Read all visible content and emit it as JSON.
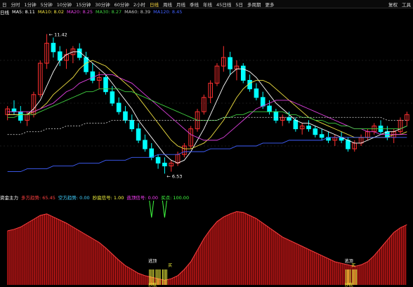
{
  "toolbar": {
    "items": [
      "日",
      "分时",
      "1分钟",
      "5分钟",
      "10分钟",
      "15分钟",
      "30分钟",
      "60分钟",
      "2小时",
      "日线",
      "周线",
      "月线",
      "季线",
      "年线",
      "45日线",
      "5日",
      "多周期",
      "更多"
    ],
    "active_index": 9,
    "right_items": [
      "复权",
      "工具"
    ]
  },
  "ma_header": {
    "title": "日线",
    "items": [
      {
        "label": "MA5",
        "value": "8.11",
        "color": "#ffffff"
      },
      {
        "label": "MA10",
        "value": "8.02",
        "color": "#f0e040"
      },
      {
        "label": "MA20",
        "value": "8.25",
        "color": "#e040e0"
      },
      {
        "label": "MA30",
        "value": "8.27",
        "color": "#40d040"
      },
      {
        "label": "MA60",
        "value": "8.39",
        "color": "#c0c0c0"
      },
      {
        "label": "MA120",
        "value": "8.45",
        "color": "#4060ff"
      }
    ]
  },
  "price_labels": {
    "high": "11.42",
    "low": "6.53"
  },
  "sub_header": {
    "items": [
      {
        "text": "资金主力",
        "color": "#ffffff"
      },
      {
        "text": "多方趋势: 65.45",
        "color": "#ff4040"
      },
      {
        "text": "空方趋势: 0.00",
        "color": "#40d0ff"
      },
      {
        "text": "抄底信号: 1.00",
        "color": "#ffff40"
      },
      {
        "text": "逃顶信号: 0.00",
        "color": "#ff40ff"
      },
      {
        "text": "买点: 100.00",
        "color": "#40ff40"
      }
    ]
  },
  "sub_labels": {
    "peak": "逃顶",
    "bottom": "抄底",
    "buy": "买"
  },
  "colors": {
    "up": "#ff3030",
    "down": "#00ffff",
    "ma5": "#ffffff",
    "ma10": "#f0e040",
    "ma20": "#e040e0",
    "ma30": "#40d040",
    "ma60": "#c0c0c0",
    "ma120": "#4060ff",
    "bars": "#d01818"
  },
  "chart_data": {
    "type": "candlestick",
    "price_range": [
      6.0,
      12.0
    ],
    "candles": [
      [
        8.6,
        8.9,
        8.4,
        8.8
      ],
      [
        8.8,
        9.1,
        8.6,
        8.7
      ],
      [
        8.7,
        8.9,
        8.3,
        8.4
      ],
      [
        8.4,
        8.7,
        8.2,
        8.6
      ],
      [
        8.6,
        9.4,
        8.5,
        9.3
      ],
      [
        9.3,
        10.5,
        9.2,
        10.4
      ],
      [
        10.4,
        11.42,
        10.2,
        11.1
      ],
      [
        11.1,
        11.3,
        10.6,
        10.8
      ],
      [
        10.8,
        11.0,
        10.3,
        10.5
      ],
      [
        10.5,
        10.9,
        10.2,
        10.7
      ],
      [
        10.7,
        11.0,
        10.4,
        10.9
      ],
      [
        10.9,
        11.1,
        10.5,
        10.6
      ],
      [
        10.6,
        10.8,
        10.0,
        10.1
      ],
      [
        10.1,
        10.4,
        9.7,
        9.8
      ],
      [
        9.8,
        10.1,
        9.5,
        9.9
      ],
      [
        9.9,
        10.0,
        9.3,
        9.4
      ],
      [
        9.4,
        9.6,
        8.9,
        9.0
      ],
      [
        9.0,
        9.2,
        8.6,
        8.7
      ],
      [
        8.7,
        8.9,
        8.3,
        8.4
      ],
      [
        8.4,
        8.6,
        8.0,
        8.1
      ],
      [
        8.1,
        8.3,
        7.6,
        7.7
      ],
      [
        7.7,
        7.9,
        7.3,
        7.4
      ],
      [
        7.4,
        7.6,
        7.0,
        7.1
      ],
      [
        7.1,
        7.2,
        6.7,
        6.9
      ],
      [
        6.9,
        7.1,
        6.53,
        6.8
      ],
      [
        6.8,
        7.0,
        6.6,
        6.9
      ],
      [
        6.9,
        7.3,
        6.8,
        7.2
      ],
      [
        7.2,
        7.6,
        7.1,
        7.5
      ],
      [
        7.5,
        8.2,
        7.4,
        8.1
      ],
      [
        8.1,
        8.8,
        8.0,
        8.7
      ],
      [
        8.7,
        9.3,
        8.6,
        9.2
      ],
      [
        9.2,
        9.8,
        9.0,
        9.7
      ],
      [
        9.7,
        10.4,
        9.6,
        10.3
      ],
      [
        10.3,
        11.0,
        10.1,
        10.6
      ],
      [
        10.6,
        10.8,
        10.0,
        10.2
      ],
      [
        10.2,
        10.5,
        9.8,
        10.3
      ],
      [
        10.3,
        10.4,
        9.7,
        9.8
      ],
      [
        9.8,
        10.0,
        9.4,
        9.5
      ],
      [
        9.5,
        9.7,
        9.1,
        9.2
      ],
      [
        9.2,
        9.4,
        8.8,
        8.9
      ],
      [
        8.9,
        9.1,
        8.6,
        8.7
      ],
      [
        8.7,
        8.8,
        8.3,
        8.4
      ],
      [
        8.4,
        8.6,
        8.2,
        8.5
      ],
      [
        8.5,
        8.7,
        8.3,
        8.4
      ],
      [
        8.4,
        8.5,
        8.0,
        8.1
      ],
      [
        8.1,
        8.3,
        7.9,
        8.2
      ],
      [
        8.2,
        8.4,
        8.0,
        8.1
      ],
      [
        8.1,
        8.2,
        7.8,
        7.9
      ],
      [
        7.9,
        8.1,
        7.7,
        7.8
      ],
      [
        7.8,
        8.0,
        7.6,
        7.7
      ],
      [
        7.7,
        7.9,
        7.5,
        7.8
      ],
      [
        7.8,
        8.0,
        7.6,
        7.7
      ],
      [
        7.7,
        7.8,
        7.3,
        7.4
      ],
      [
        7.4,
        7.7,
        7.3,
        7.6
      ],
      [
        7.6,
        7.9,
        7.5,
        7.8
      ],
      [
        7.8,
        8.1,
        7.7,
        8.0
      ],
      [
        8.0,
        8.3,
        7.9,
        8.2
      ],
      [
        8.2,
        8.4,
        7.9,
        8.0
      ],
      [
        8.0,
        8.2,
        7.7,
        7.8
      ],
      [
        7.8,
        8.1,
        7.6,
        8.0
      ],
      [
        8.0,
        8.5,
        7.9,
        8.4
      ],
      [
        8.4,
        8.7,
        8.2,
        8.6
      ]
    ],
    "ma_series": {
      "ma5": [
        8.6,
        8.6,
        8.6,
        8.6,
        8.8,
        9.1,
        9.6,
        10.1,
        10.5,
        10.7,
        10.8,
        10.8,
        10.6,
        10.4,
        10.2,
        10.0,
        9.7,
        9.4,
        9.1,
        8.8,
        8.4,
        8.1,
        7.8,
        7.5,
        7.2,
        7.0,
        6.9,
        7.0,
        7.3,
        7.7,
        8.1,
        8.6,
        9.1,
        9.6,
        10.0,
        10.2,
        10.2,
        10.1,
        9.9,
        9.6,
        9.3,
        9.0,
        8.8,
        8.6,
        8.4,
        8.3,
        8.3,
        8.2,
        8.1,
        8.0,
        7.9,
        7.8,
        7.7,
        7.6,
        7.6,
        7.7,
        7.8,
        7.9,
        8.0,
        8.0,
        8.1,
        8.2
      ],
      "ma10": [
        8.6,
        8.6,
        8.6,
        8.6,
        8.7,
        8.8,
        9.0,
        9.3,
        9.5,
        9.7,
        9.9,
        10.2,
        10.4,
        10.5,
        10.4,
        10.3,
        10.1,
        9.9,
        9.7,
        9.5,
        9.2,
        8.9,
        8.6,
        8.3,
        8.0,
        7.7,
        7.5,
        7.4,
        7.4,
        7.5,
        7.6,
        7.8,
        8.1,
        8.4,
        8.8,
        9.2,
        9.5,
        9.7,
        9.8,
        9.8,
        9.7,
        9.5,
        9.3,
        9.1,
        8.9,
        8.7,
        8.5,
        8.4,
        8.3,
        8.2,
        8.1,
        8.0,
        7.9,
        7.8,
        7.8,
        7.8,
        7.8,
        7.8,
        7.8,
        7.9,
        7.9,
        8.0
      ],
      "ma20": [
        8.7,
        8.7,
        8.7,
        8.7,
        8.7,
        8.8,
        8.9,
        9.0,
        9.2,
        9.4,
        9.5,
        9.7,
        9.8,
        9.9,
        10.0,
        10.0,
        10.0,
        9.9,
        9.8,
        9.7,
        9.5,
        9.3,
        9.1,
        8.9,
        8.7,
        8.5,
        8.3,
        8.1,
        7.9,
        7.8,
        7.7,
        7.7,
        7.7,
        7.8,
        8.0,
        8.2,
        8.4,
        8.6,
        8.8,
        8.9,
        9.0,
        9.1,
        9.1,
        9.1,
        9.0,
        8.9,
        8.8,
        8.7,
        8.6,
        8.5,
        8.4,
        8.3,
        8.2,
        8.1,
        8.1,
        8.0,
        8.0,
        7.9,
        7.9,
        7.9,
        7.9,
        7.9
      ],
      "ma30": [
        8.5,
        8.5,
        8.6,
        8.6,
        8.6,
        8.7,
        8.8,
        8.9,
        9.0,
        9.1,
        9.2,
        9.3,
        9.4,
        9.4,
        9.5,
        9.5,
        9.5,
        9.5,
        9.4,
        9.4,
        9.3,
        9.2,
        9.1,
        9.0,
        8.9,
        8.8,
        8.7,
        8.6,
        8.5,
        8.4,
        8.4,
        8.4,
        8.4,
        8.5,
        8.5,
        8.6,
        8.6,
        8.7,
        8.7,
        8.7,
        8.7,
        8.7,
        8.7,
        8.6,
        8.6,
        8.5,
        8.5,
        8.4,
        8.4,
        8.3,
        8.3,
        8.2,
        8.2,
        8.1,
        8.1,
        8.1,
        8.1,
        8.1,
        8.1,
        8.1,
        8.1,
        8.2
      ],
      "ma60": [
        7.9,
        7.9,
        7.9,
        8.0,
        8.0,
        8.0,
        8.1,
        8.1,
        8.1,
        8.2,
        8.2,
        8.2,
        8.3,
        8.3,
        8.3,
        8.3,
        8.4,
        8.4,
        8.4,
        8.4,
        8.4,
        8.4,
        8.4,
        8.4,
        8.4,
        8.4,
        8.4,
        8.4,
        8.4,
        8.4,
        8.4,
        8.4,
        8.4,
        8.5,
        8.5,
        8.5,
        8.5,
        8.5,
        8.5,
        8.5,
        8.5,
        8.5,
        8.5,
        8.5,
        8.5,
        8.5,
        8.5,
        8.5,
        8.5,
        8.5,
        8.5,
        8.5,
        8.5,
        8.5,
        8.5,
        8.5,
        8.5,
        8.5,
        8.4,
        8.4,
        8.4,
        8.4
      ],
      "ma120": [
        6.6,
        6.6,
        6.6,
        6.7,
        6.7,
        6.7,
        6.7,
        6.8,
        6.8,
        6.8,
        6.8,
        6.9,
        6.9,
        6.9,
        6.9,
        7.0,
        7.0,
        7.0,
        7.0,
        7.1,
        7.1,
        7.1,
        7.1,
        7.2,
        7.2,
        7.2,
        7.2,
        7.3,
        7.3,
        7.3,
        7.3,
        7.4,
        7.4,
        7.4,
        7.4,
        7.5,
        7.5,
        7.5,
        7.5,
        7.6,
        7.6,
        7.6,
        7.6,
        7.7,
        7.7,
        7.7,
        7.7,
        7.7,
        7.7,
        7.8,
        7.8,
        7.8,
        7.8,
        7.8,
        7.8,
        7.8,
        7.8,
        7.8,
        7.8,
        7.8,
        7.8,
        7.8
      ]
    },
    "indicator": [
      70,
      72,
      75,
      80,
      85,
      90,
      92,
      88,
      84,
      80,
      75,
      70,
      65,
      60,
      55,
      48,
      40,
      32,
      25,
      20,
      15,
      12,
      10,
      8,
      6,
      8,
      12,
      20,
      30,
      45,
      60,
      72,
      82,
      88,
      92,
      95,
      94,
      90,
      86,
      80,
      74,
      68,
      62,
      58,
      54,
      50,
      46,
      42,
      38,
      34,
      30,
      28,
      26,
      24,
      26,
      30,
      38,
      48,
      58,
      68,
      74,
      78
    ],
    "indicator_range": [
      0,
      100
    ]
  }
}
